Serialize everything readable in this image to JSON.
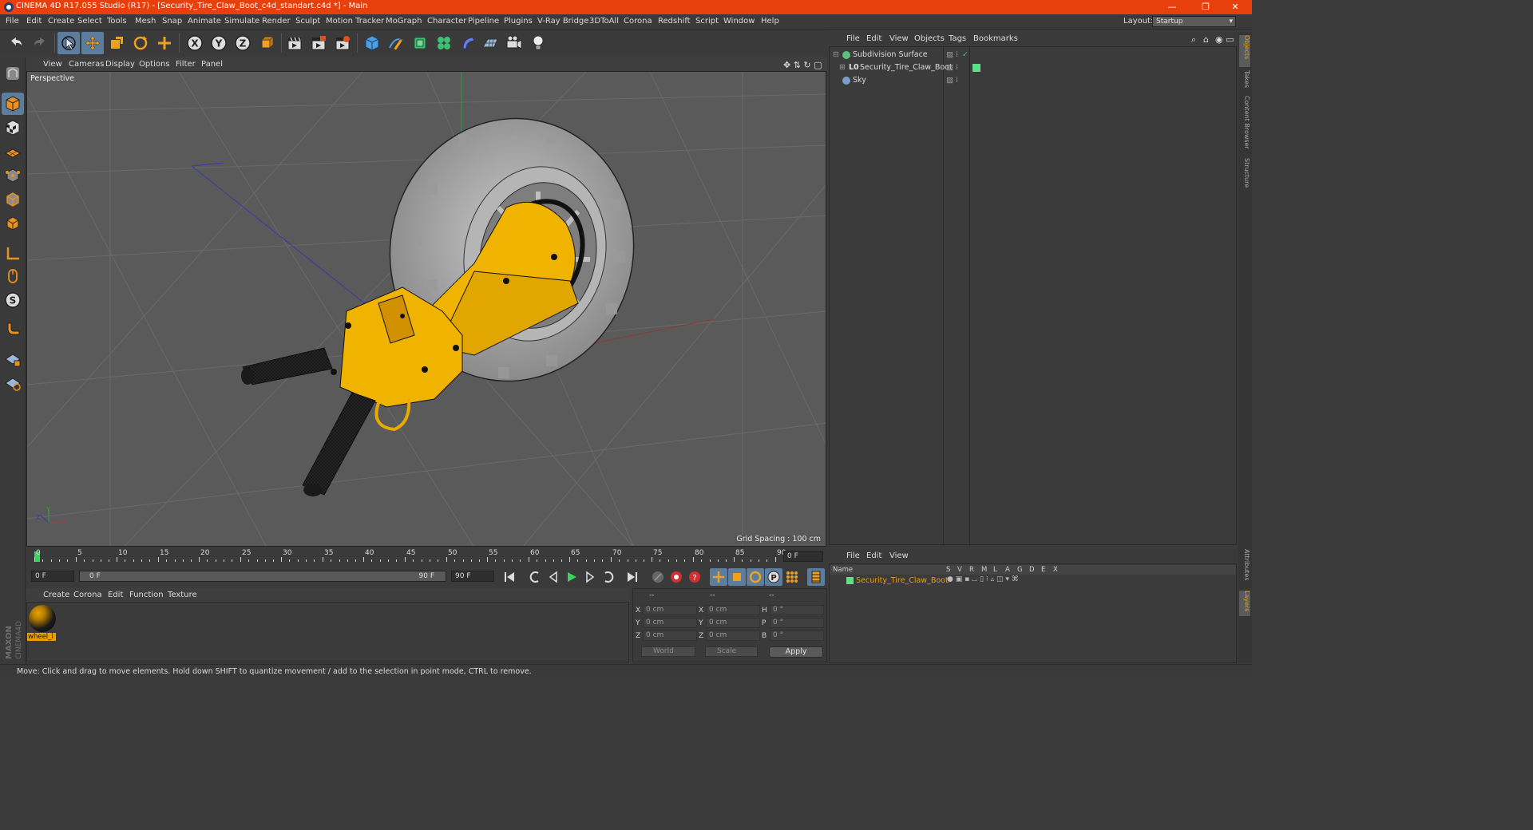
{
  "window": {
    "title": "CINEMA 4D R17.055 Studio (R17) - [Security_Tire_Claw_Boot_c4d_standart.c4d *] - Main",
    "minimize": "—",
    "restore": "❐",
    "close": "✕"
  },
  "menubar": {
    "items": [
      "File",
      "Edit",
      "Create",
      "Select",
      "Tools",
      "Mesh",
      "Snap",
      "Animate",
      "Simulate",
      "Render",
      "Sculpt",
      "Motion Tracker",
      "MoGraph",
      "Character",
      "Pipeline",
      "Plugins",
      "V-Ray Bridge",
      "3DToAll",
      "Corona",
      "Redshift",
      "Script",
      "Window",
      "Help"
    ],
    "layout_label": "Layout:",
    "layout_value": "Startup"
  },
  "viewport": {
    "menu": [
      "View",
      "Cameras",
      "Display",
      "Options",
      "Filter",
      "Panel"
    ],
    "name": "Perspective",
    "grid_spacing": "Grid Spacing : 100 cm"
  },
  "timeline": {
    "ticks": [
      "0",
      "5",
      "10",
      "15",
      "20",
      "25",
      "30",
      "35",
      "40",
      "45",
      "50",
      "55",
      "60",
      "65",
      "70",
      "75",
      "80",
      "85",
      "90"
    ],
    "end_frame_box": "0 F",
    "current_frame": "0 F",
    "range_start": "0 F",
    "range_end": "90 F",
    "max_frame": "90 F"
  },
  "materials": {
    "menu": [
      "Create",
      "Corona",
      "Edit",
      "Function",
      "Texture"
    ],
    "items": [
      {
        "name": "wheel_l"
      }
    ]
  },
  "coords": {
    "headers": [
      "--",
      "--",
      "--"
    ],
    "rows": [
      {
        "a": "X",
        "av": "0 cm",
        "b": "X",
        "bv": "0 cm",
        "c": "H",
        "cv": "0 °"
      },
      {
        "a": "Y",
        "av": "0 cm",
        "b": "Y",
        "bv": "0 cm",
        "c": "P",
        "cv": "0 °"
      },
      {
        "a": "Z",
        "av": "0 cm",
        "b": "Z",
        "bv": "0 cm",
        "c": "B",
        "cv": "0 °"
      }
    ],
    "mode1": "World",
    "mode2": "Scale",
    "apply": "Apply"
  },
  "status": {
    "text": "Move: Click and drag to move elements. Hold down SHIFT to quantize movement / add to the selection in point mode, CTRL to remove."
  },
  "object_manager": {
    "menu": [
      "File",
      "Edit",
      "View",
      "Objects",
      "Tags",
      "Bookmarks"
    ],
    "objects": [
      {
        "name": "Subdivision Surface",
        "icon_color": "#5ec17a"
      },
      {
        "name": "Security_Tire_Claw_Boot",
        "icon_color": "#d8d8d8"
      },
      {
        "name": "Sky",
        "icon_color": "#7a9ec8"
      }
    ]
  },
  "layer_manager": {
    "menu": [
      "File",
      "Edit",
      "View"
    ],
    "columns": [
      "Name",
      "S",
      "V",
      "R",
      "M",
      "L",
      "A",
      "G",
      "D",
      "E",
      "X"
    ],
    "layers": [
      {
        "name": "Security_Tire_Claw_Boot",
        "color": "#5ee08a"
      }
    ]
  },
  "side_tabs": [
    "Objects",
    "Takes",
    "Content Browser",
    "Structure"
  ],
  "side_tabs_bottom": [
    "Attributes",
    "Layers"
  ],
  "colors": {
    "accent": "#e8400c",
    "selection": "#5d7d9e",
    "model_yellow": "#f0b400"
  }
}
